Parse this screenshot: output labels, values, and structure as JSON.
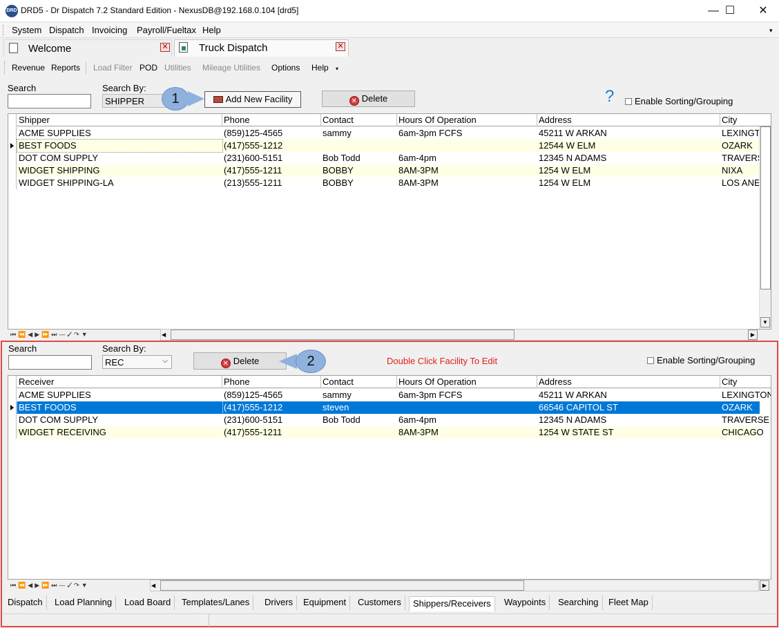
{
  "window": {
    "title": "DRD5 - Dr Dispatch 7.2 Standard Edition - NexusDB@192.168.0.104 [drd5]",
    "icon_text": "DRD",
    "minimize": "—",
    "maximize": "☐",
    "close": "✕"
  },
  "menu": [
    "System",
    "Dispatch",
    "Invoicing",
    "Payroll/Fueltax",
    "Help"
  ],
  "doc_tabs": [
    {
      "label": "Welcome",
      "icon": "page-icon"
    },
    {
      "label": "Truck Dispatch",
      "icon": "excel-page-icon"
    }
  ],
  "toolbar": {
    "items": [
      {
        "label": "Revenue",
        "enabled": true
      },
      {
        "label": "Reports",
        "enabled": true
      },
      {
        "label": "Load Filter",
        "enabled": false
      },
      {
        "label": "POD",
        "enabled": true
      },
      {
        "label": "Utilities",
        "enabled": false
      },
      {
        "label": "Mileage Utilities",
        "enabled": false
      },
      {
        "label": "Options",
        "enabled": true
      },
      {
        "label": "Help",
        "enabled": true
      }
    ]
  },
  "shipper_panel": {
    "search_label": "Search",
    "search_value": "",
    "search_by_label": "Search By:",
    "search_by_value": "SHIPPER",
    "callout": "1",
    "add_button": "Add New Facility",
    "delete_button": "Delete",
    "help_glyph": "?",
    "sorting_label": "Enable Sorting/Grouping",
    "columns": [
      "Shipper",
      "Phone",
      "Contact",
      "Hours Of Operation",
      "Address",
      "City"
    ],
    "rows": [
      [
        "ACME SUPPLIES",
        "(859)125-4565",
        "sammy",
        "6am-3pm FCFS",
        "45211 W ARKAN",
        "LEXINGT"
      ],
      [
        "BEST FOODS",
        "(417)555-1212",
        "",
        "",
        "12544 W ELM",
        "OZARK"
      ],
      [
        "DOT COM SUPPLY",
        "(231)600-5151",
        "Bob Todd",
        "6am-4pm",
        "12345 N ADAMS",
        "TRAVERS"
      ],
      [
        "WIDGET SHIPPING",
        "(417)555-1211",
        "BOBBY",
        "8AM-3PM",
        "1254 W ELM",
        "NIXA"
      ],
      [
        "WIDGET SHIPPING-LA",
        "(213)555-1211",
        "BOBBY",
        "8AM-3PM",
        "1254 W ELM",
        "LOS ANE"
      ]
    ],
    "current_row": 1
  },
  "receiver_panel": {
    "search_label": "Search",
    "search_value": "",
    "search_by_label": "Search By:",
    "search_by_value": "REC",
    "callout": "2",
    "delete_button": "Delete",
    "hint": "Double Click Facility To Edit",
    "hint_color": "#e0201c",
    "sorting_label": "Enable Sorting/Grouping",
    "columns": [
      "Receiver",
      "Phone",
      "Contact",
      "Hours Of Operation",
      "Address",
      "City"
    ],
    "rows": [
      [
        "ACME SUPPLIES",
        "(859)125-4565",
        "sammy",
        "6am-3pm FCFS",
        "45211 W ARKAN",
        "LEXINGTON"
      ],
      [
        "BEST FOODS",
        "(417)555-1212",
        "steven",
        "",
        "66546 CAPITOL ST",
        "OZARK"
      ],
      [
        "DOT COM SUPPLY",
        "(231)600-5151",
        "Bob Todd",
        "6am-4pm",
        "12345 N ADAMS",
        "TRAVERSE C"
      ],
      [
        "WIDGET RECEIVING",
        "(417)555-1211",
        "",
        "8AM-3PM",
        "1254 W STATE ST",
        "CHICAGO"
      ]
    ],
    "selected_row": 1
  },
  "navigator": "⏮⏪◀▶⏩⏭—✓↷▼",
  "bottom_tabs": [
    "Dispatch",
    "Load Planning",
    "Load Board",
    "Templates/Lanes",
    "Drivers",
    "Equipment",
    "Customers",
    "Shippers/Receivers",
    "Waypoints",
    "Searching",
    "Fleet Map"
  ],
  "active_bottom_tab": "Shippers/Receivers",
  "colors": {
    "selection": "#0078d7",
    "alt_row": "#ffffe6",
    "callout": "#8fb1dd",
    "outline": "#e04848"
  }
}
